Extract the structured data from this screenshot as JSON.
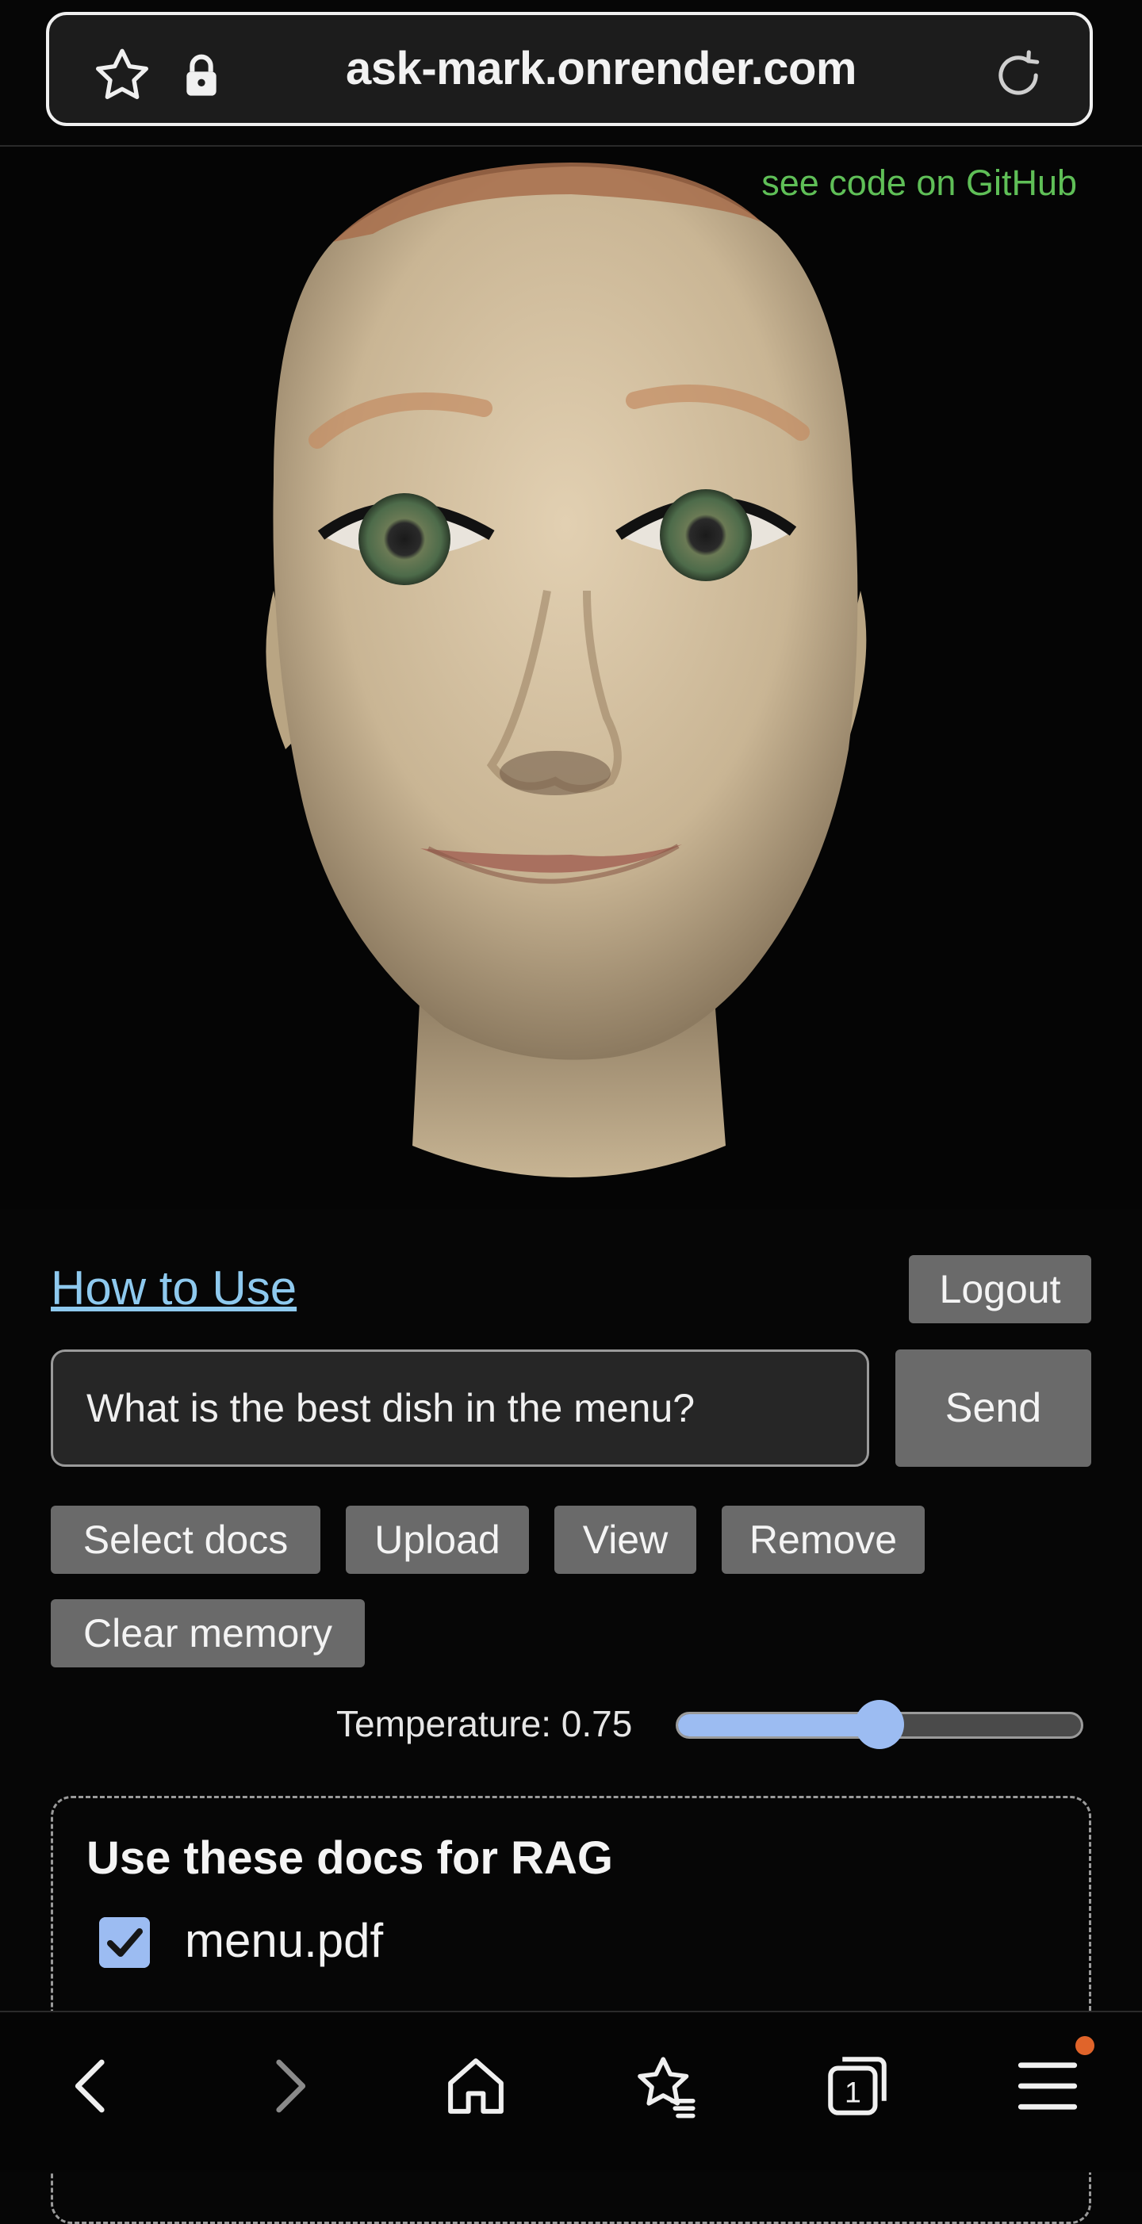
{
  "browser": {
    "url": "ask-mark.onrender.com"
  },
  "header": {
    "github_link": "see code on GitHub"
  },
  "controls": {
    "how_to_use": "How to Use",
    "logout": "Logout",
    "message_value": "What is the best dish in the menu?",
    "send": "Send",
    "buttons": {
      "select_docs": "Select docs",
      "upload": "Upload",
      "view": "View",
      "remove": "Remove",
      "clear_memory": "Clear memory"
    },
    "temperature_label": "Temperature: 0.75",
    "temperature_value": 0.75,
    "temperature_slider_fraction": 0.5
  },
  "rag": {
    "title": "Use these docs for RAG",
    "docs": [
      {
        "name": "menu.pdf",
        "checked": true
      }
    ]
  },
  "colors": {
    "accent": "#9cbcf2",
    "link": "#8ec9ee",
    "github": "#5fbf57",
    "button": "#6a6a6a",
    "notification": "#e0642a"
  },
  "icons": [
    "star-icon",
    "lock-icon",
    "reload-icon",
    "back-icon",
    "forward-icon",
    "home-icon",
    "bookmarks-icon",
    "tabs-icon",
    "menu-icon"
  ],
  "tab_count": "1"
}
